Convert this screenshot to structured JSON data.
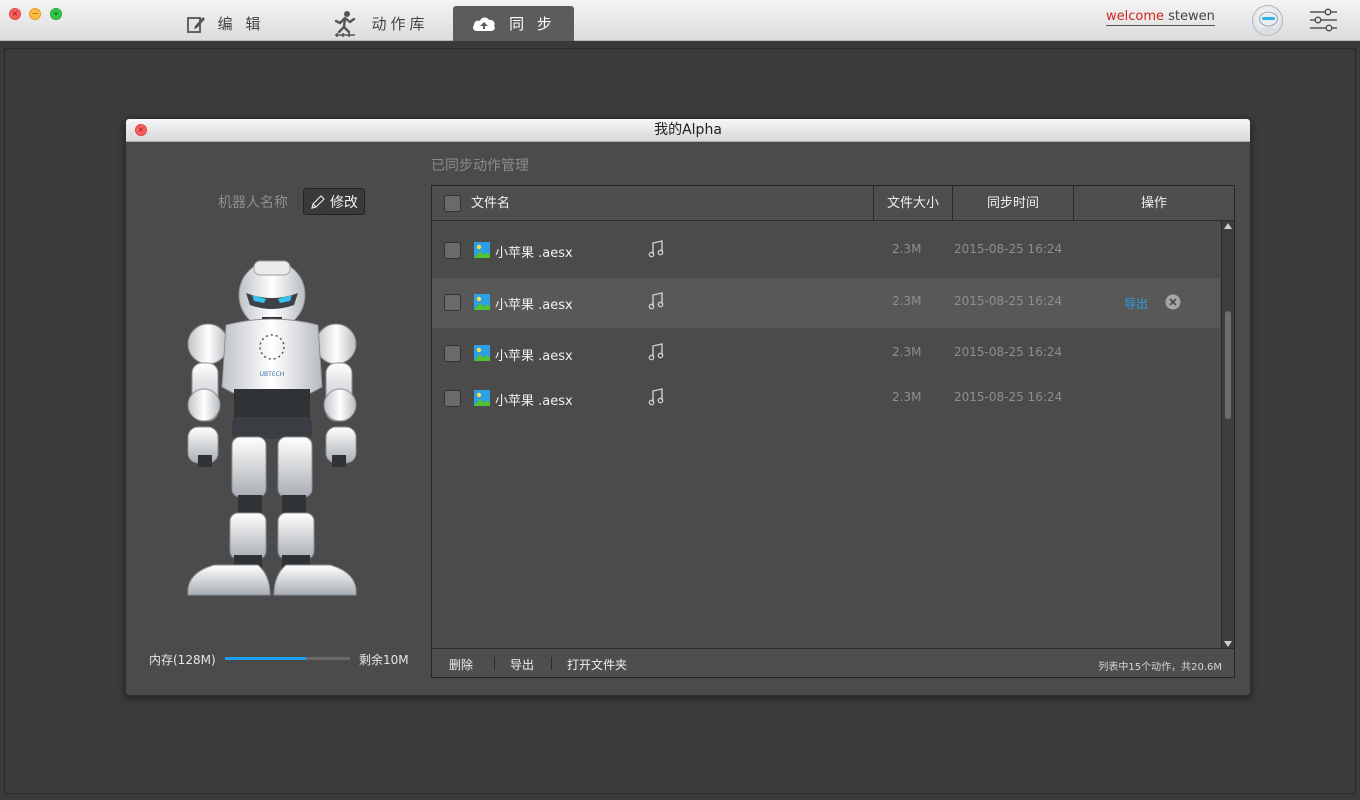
{
  "window": {
    "tabs": [
      {
        "label": "编 辑",
        "icon": "edit-icon"
      },
      {
        "label": "动作库",
        "icon": "action-figure-icon"
      },
      {
        "label": "同 步",
        "icon": "cloud-sync-icon",
        "active": true
      }
    ],
    "welcome_prefix": "welcome",
    "username": "stewen",
    "accent_color": "#d0261d"
  },
  "dialog": {
    "title": "我的Alpha",
    "robot_name_label": "机器人名称",
    "edit_button_label": "修改",
    "memory_label": "内存(128M)",
    "memory_remaining_label": "剩余10M",
    "memory_used_fraction": 0.65,
    "section_title": "已同步动作管理",
    "table": {
      "headers": {
        "name": "文件名",
        "size": "文件大小",
        "time": "同步时间",
        "action": "操作"
      },
      "rows": [
        {
          "name": "小苹果  .aesx",
          "size": "2.3M",
          "time": "2015-08-25  16:24",
          "selected": false
        },
        {
          "name": "小苹果  .aesx",
          "size": "2.3M",
          "time": "2015-08-25  16:24",
          "selected": true,
          "action_label": "导出"
        },
        {
          "name": "小苹果  .aesx",
          "size": "2.3M",
          "time": "2015-08-25  16:24",
          "selected": false
        },
        {
          "name": "小苹果  .aesx",
          "size": "2.3M",
          "time": "2015-08-25  16:24",
          "selected": false
        }
      ]
    },
    "footer": {
      "delete_label": "删除",
      "export_label": "导出",
      "open_folder_label": "打开文件夹",
      "status_text": "列表中15个动作，共20.6M"
    },
    "link_color": "#2d9ee8",
    "progress_color": "#1aa0ee"
  }
}
